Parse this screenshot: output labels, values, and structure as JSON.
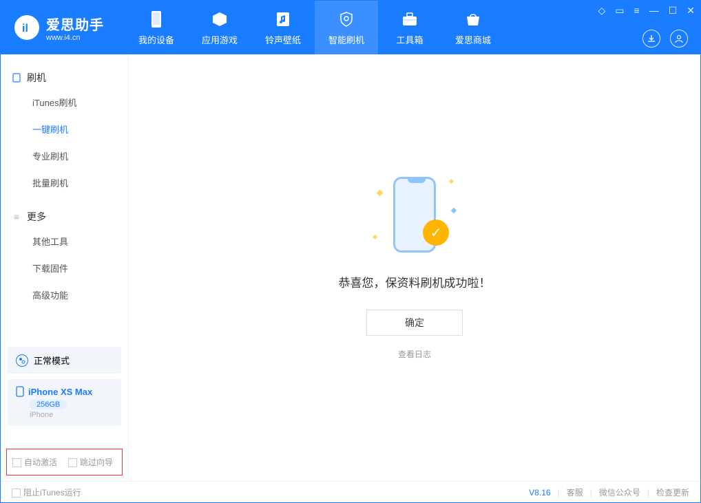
{
  "app": {
    "title": "爱思助手",
    "subtitle": "www.i4.cn"
  },
  "nav": {
    "tabs": [
      {
        "label": "我的设备"
      },
      {
        "label": "应用游戏"
      },
      {
        "label": "铃声壁纸"
      },
      {
        "label": "智能刷机"
      },
      {
        "label": "工具箱"
      },
      {
        "label": "爱思商城"
      }
    ]
  },
  "sidebar": {
    "section1": {
      "title": "刷机",
      "items": [
        "iTunes刷机",
        "一键刷机",
        "专业刷机",
        "批量刷机"
      ]
    },
    "section2": {
      "title": "更多",
      "items": [
        "其他工具",
        "下载固件",
        "高级功能"
      ]
    },
    "mode": "正常模式",
    "device": {
      "name": "iPhone XS Max",
      "capacity": "256GB",
      "type": "iPhone"
    },
    "options": {
      "auto_activate": "自动激活",
      "skip_guide": "跳过向导"
    }
  },
  "main": {
    "success_text": "恭喜您，保资料刷机成功啦！",
    "ok_button": "确定",
    "view_log": "查看日志"
  },
  "footer": {
    "block_itunes": "阻止iTunes运行",
    "version": "V8.16",
    "links": [
      "客服",
      "微信公众号",
      "检查更新"
    ]
  }
}
